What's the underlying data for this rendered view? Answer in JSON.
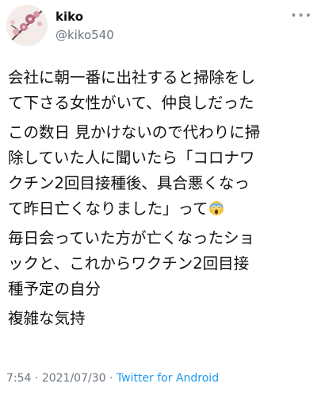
{
  "user": {
    "display_name": "kiko",
    "handle": "@kiko540"
  },
  "more_label": "•••",
  "tweet": {
    "paragraphs": [
      [
        "会社に朝一番に出社すると掃除をし",
        "て下さる女性がいて、仲良しだった"
      ],
      [
        "この数日 見かけないので代わりに掃",
        "除していた人に聞いたら「コロナワ",
        "クチン2回目接種後、具合悪くなっ",
        "て昨日亡くなりました」って"
      ],
      [
        "毎日会っていた方が亡くなったショ",
        "ックと、これからワクチン2回目接",
        "種予定の自分"
      ],
      [
        "複雑な気持"
      ]
    ],
    "emoji": "face-screaming-in-fear"
  },
  "footer": {
    "time": "7:54",
    "sep1": " · ",
    "date": "2021/07/30",
    "sep2": " · ",
    "source": "Twitter for Android"
  },
  "colors": {
    "text": "#111111",
    "muted": "#6b7580",
    "link": "#1d9bf0"
  }
}
